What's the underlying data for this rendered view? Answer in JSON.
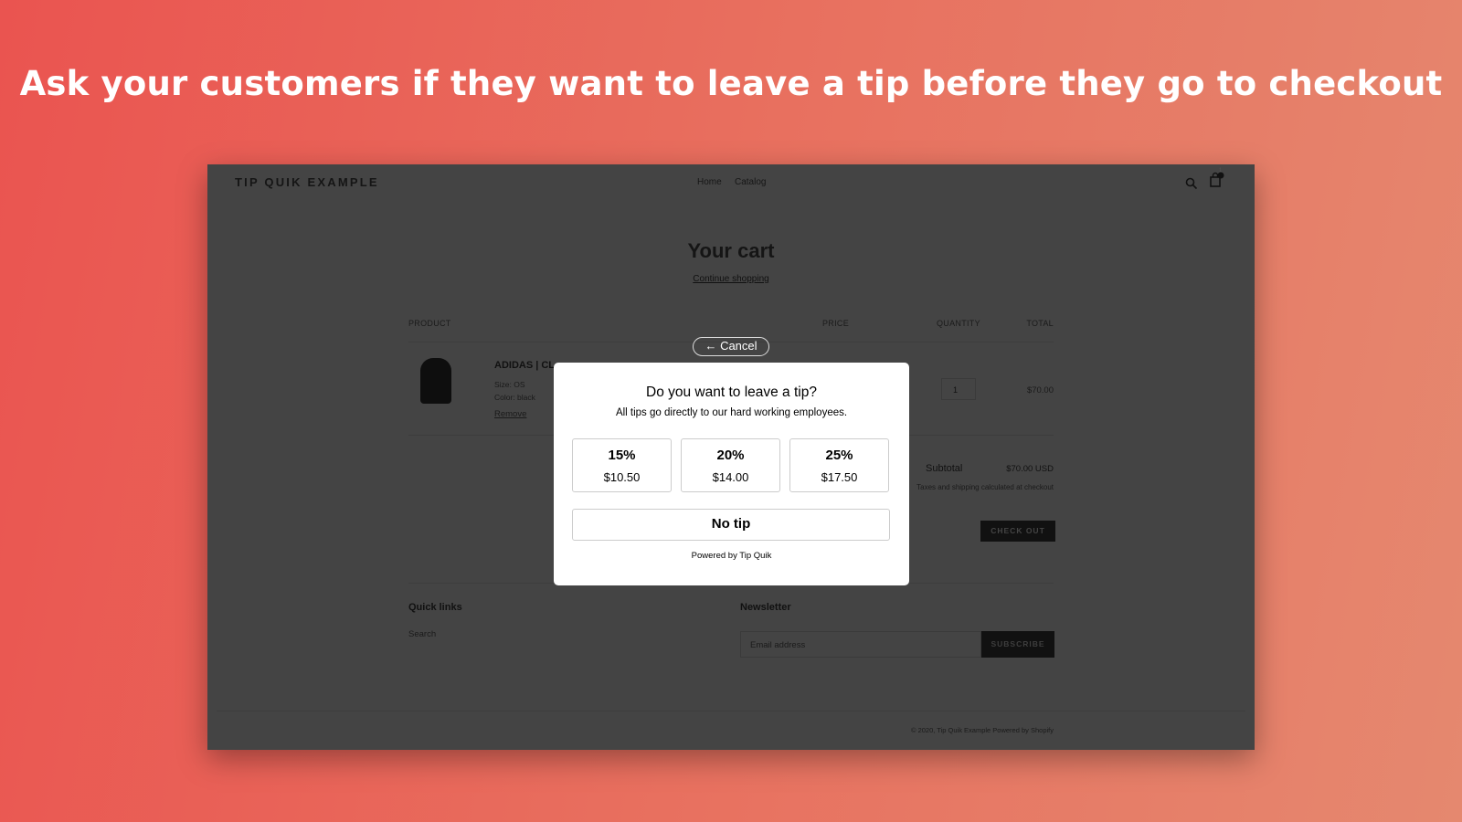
{
  "headline": "Ask your customers if they want to leave a tip before they go to checkout",
  "store": {
    "logo": "TIP QUIK EXAMPLE",
    "nav": [
      "Home",
      "Catalog"
    ],
    "cart_count": "1",
    "icons": [
      "search-icon",
      "cart-icon"
    ],
    "page_title": "Your cart",
    "continue_shopping": "Continue shopping",
    "columns": {
      "product": "PRODUCT",
      "price": "PRICE",
      "quantity": "QUANTITY",
      "total": "TOTAL"
    },
    "item": {
      "title": "ADIDAS | CL",
      "size": "Size: OS",
      "color": "Color: black",
      "remove": "Remove",
      "quantity": "1",
      "total": "$70.00"
    },
    "subtotal_label": "Subtotal",
    "subtotal_value": "$70.00 USD",
    "taxes_note": "Taxes and shipping calculated at checkout",
    "checkout": "CHECK OUT",
    "footer": {
      "quick_links": "Quick links",
      "search": "Search",
      "newsletter": "Newsletter",
      "email_placeholder": "Email address",
      "subscribe": "SUBSCRIBE",
      "copyright": "© 2020, Tip Quik Example Powered by Shopify"
    }
  },
  "modal": {
    "cancel": "← Cancel",
    "title": "Do you want to leave a tip?",
    "subtitle": "All tips go directly to our hard working employees.",
    "options": [
      {
        "percent": "15%",
        "amount": "$10.50"
      },
      {
        "percent": "20%",
        "amount": "$14.00"
      },
      {
        "percent": "25%",
        "amount": "$17.50"
      }
    ],
    "no_tip": "No tip",
    "powered": "Powered by Tip Quik"
  },
  "colors": {
    "background_start": "#ea5450",
    "background_end": "#e5886f",
    "overlay": "#444444"
  }
}
